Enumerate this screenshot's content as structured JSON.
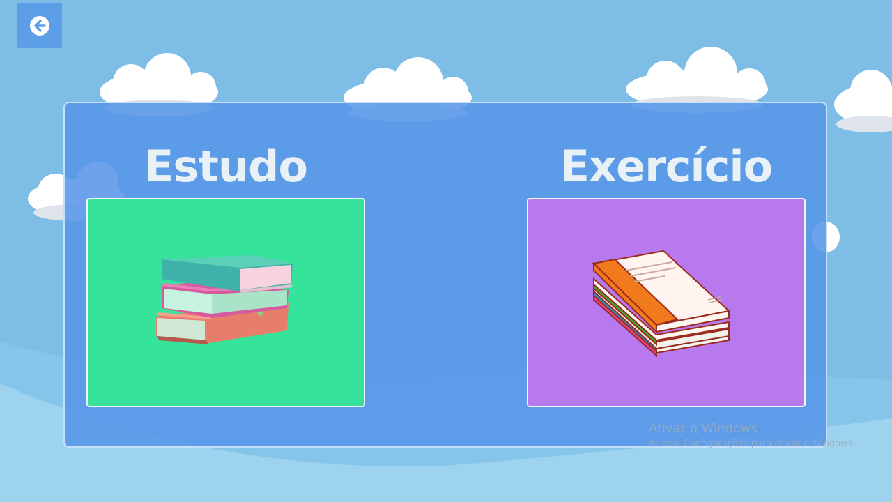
{
  "nav": {
    "back_icon": "arrow-left-circle-icon"
  },
  "cards": [
    {
      "title": "Estudo",
      "icon": "book-stack-icon",
      "color": "#36e39b"
    },
    {
      "title": "Exercício",
      "icon": "notebook-stack-icon",
      "color": "#b979ee"
    }
  ],
  "watermark": {
    "title": "Ativar o Windows",
    "subtitle": "Acesse Configurações para ativar o Windows."
  },
  "colors": {
    "sky": "#7dbde6",
    "panel": "#5896e8",
    "button": "#5c9ee8"
  }
}
